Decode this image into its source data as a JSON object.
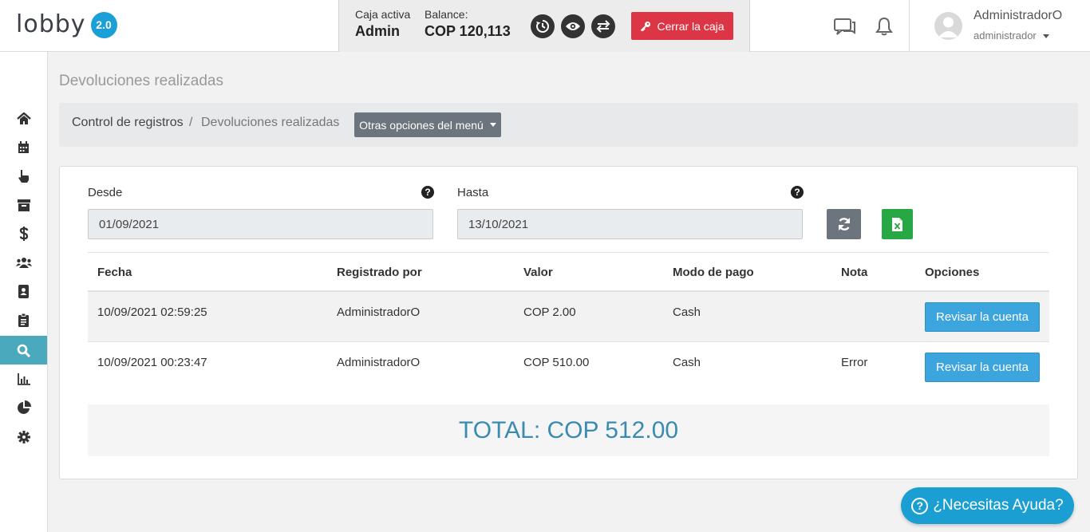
{
  "brand": {
    "logo_text": "lobby",
    "version_badge": "2.0"
  },
  "cashbox": {
    "active_label": "Caja activa",
    "active_value": "Admin",
    "balance_label": "Balance:",
    "balance_value": "COP 120,113",
    "close_button": "Cerrar la caja"
  },
  "user": {
    "name": "AdministradorO",
    "role": "administrador"
  },
  "sidebar": {
    "active_item": "search",
    "items": [
      "home-icon",
      "calendar-icon",
      "pointer-icon",
      "archive-icon",
      "dollar-icon",
      "users-icon",
      "contacts-icon",
      "clipboard-icon",
      "search-icon",
      "bar-chart-icon",
      "pie-chart-icon",
      "gear-icon"
    ]
  },
  "page": {
    "title": "Devoluciones realizadas",
    "breadcrumb": {
      "root": "Control de registros",
      "separator": "/",
      "current": "Devoluciones realizadas"
    },
    "menu_button": "Otras opciones del menú"
  },
  "filters": {
    "from_label": "Desde",
    "from_value": "01/09/2021",
    "to_label": "Hasta",
    "to_value": "13/10/2021",
    "help_glyph": "?"
  },
  "table": {
    "headers": {
      "date": "Fecha",
      "registered_by": "Registrado por",
      "value": "Valor",
      "payment_mode": "Modo de pago",
      "note": "Nota",
      "options": "Opciones"
    },
    "rows": [
      {
        "date": "10/09/2021 02:59:25",
        "registered_by": "AdministradorO",
        "value": "COP 2.00",
        "payment_mode": "Cash",
        "note": "",
        "action": "Revisar la cuenta"
      },
      {
        "date": "10/09/2021 00:23:47",
        "registered_by": "AdministradorO",
        "value": "COP 510.00",
        "payment_mode": "Cash",
        "note": "Error",
        "action": "Revisar la cuenta"
      }
    ]
  },
  "total": "TOTAL: COP 512.00",
  "help_fab": "¿Necesitas Ayuda?",
  "colors": {
    "accent": "#1b9fd3",
    "danger": "#dc3545",
    "success": "#28a745",
    "sidebar_active": "#4aa9bd",
    "total_text": "#3a8bb0"
  }
}
